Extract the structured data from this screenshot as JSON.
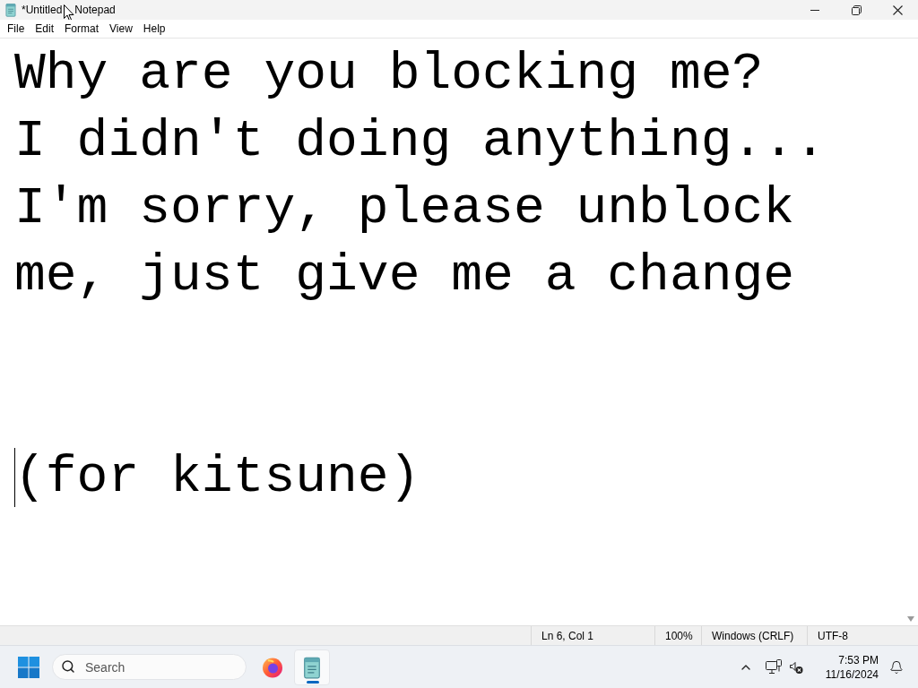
{
  "window": {
    "title_parts": [
      "*Untitled",
      "Notepad"
    ]
  },
  "menu": [
    "File",
    "Edit",
    "Format",
    "View",
    "Help"
  ],
  "editor": {
    "lines": [
      {
        "kind": "text",
        "text": "Why are you blocking me?",
        "caret": false
      },
      {
        "kind": "text",
        "text": "I didn't doing anything...",
        "caret": false
      },
      {
        "kind": "text",
        "text": "I'm sorry, please unblock me, just give me a change",
        "caret": false
      },
      {
        "kind": "blank",
        "caret": false
      },
      {
        "kind": "blank",
        "caret": false
      },
      {
        "kind": "text",
        "text": "(for kitsune)",
        "caret": true
      }
    ]
  },
  "status_bar": [
    "Ln 6, Col 1",
    "100%",
    "Windows (CRLF)",
    "UTF-8"
  ],
  "taskbar": {
    "search": {
      "placeholder": "Search"
    },
    "apps": [
      {
        "kind": "firefox",
        "active": false
      },
      {
        "kind": "notepad",
        "active": true
      }
    ],
    "clock": {
      "time": "7:53 PM",
      "date": "11/16/2024"
    }
  }
}
